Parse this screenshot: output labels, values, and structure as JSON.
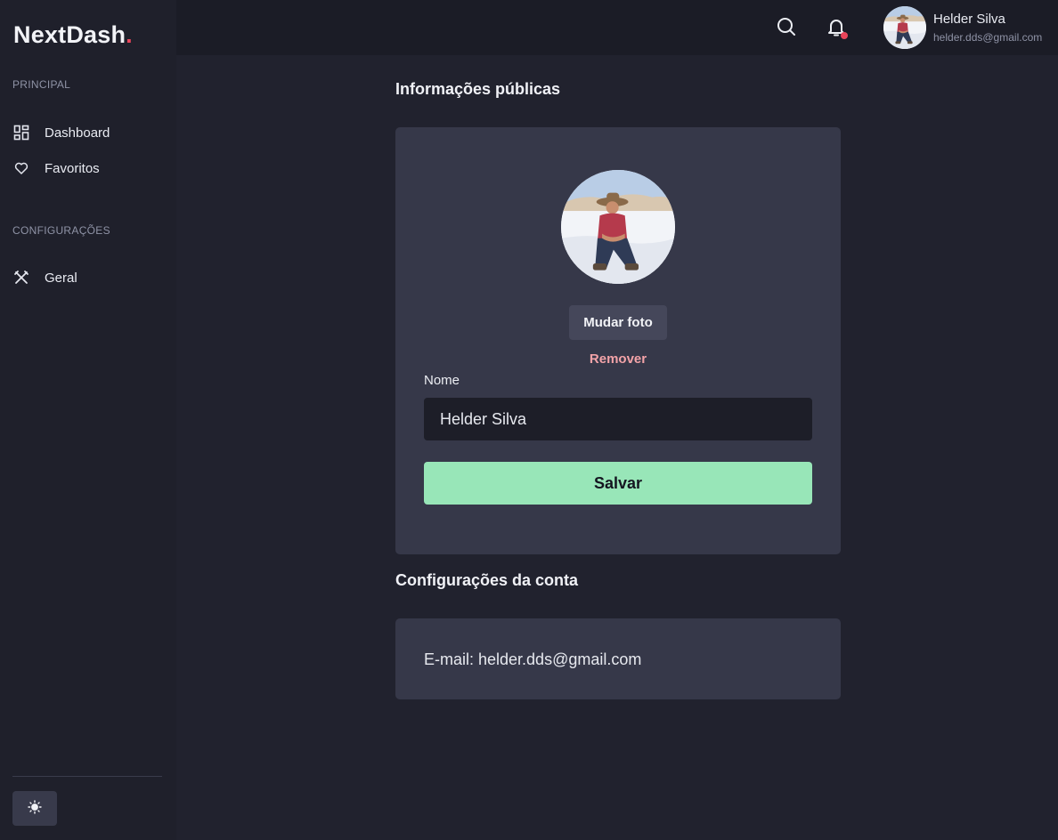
{
  "brand": {
    "name": "NextDash",
    "dot": ".",
    "accent": "#e9455a"
  },
  "sidebar": {
    "sections": [
      {
        "title": "PRINCIPAL",
        "items": [
          {
            "label": "Dashboard",
            "icon": "dashboard-grid-icon"
          },
          {
            "label": "Favoritos",
            "icon": "heart-icon"
          }
        ]
      },
      {
        "title": "CONFIGURAÇÕES",
        "items": [
          {
            "label": "Geral",
            "icon": "tools-icon"
          }
        ]
      }
    ],
    "theme_toggle_icon": "sun-icon"
  },
  "header": {
    "search_icon": "search-icon",
    "notifications_icon": "bell-icon",
    "has_unread_notifications": true,
    "user": {
      "name": "Helder Silva",
      "email": "helder.dds@gmail.com"
    }
  },
  "public_info": {
    "heading": "Informações públicas",
    "change_photo_label": "Mudar foto",
    "remove_label": "Remover",
    "name_label": "Nome",
    "name_value": "Helder Silva",
    "save_label": "Salvar"
  },
  "account": {
    "heading": "Configurações da conta",
    "email_line": "E-mail: helder.dds@gmail.com"
  },
  "colors": {
    "background": "#21222e",
    "card": "#363849",
    "save_button": "#98e6b8",
    "remove_link": "#f3a3a8"
  }
}
